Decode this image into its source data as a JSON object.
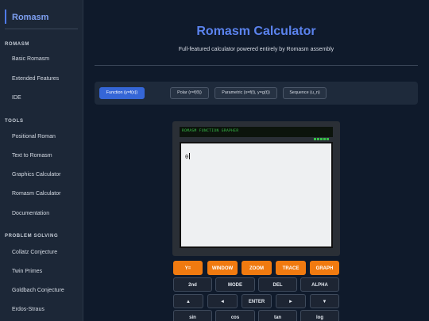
{
  "sidebar": {
    "brand": "Romasm",
    "sections": [
      {
        "title": "ROMASM",
        "items": [
          "Basic Romasm",
          "Extended Features",
          "IDE"
        ]
      },
      {
        "title": "TOOLS",
        "items": [
          "Positional Roman",
          "Text to Romasm",
          "Graphics Calculator",
          "Romasm Calculator",
          "Documentation"
        ]
      },
      {
        "title": "PROBLEM SOLVING",
        "items": [
          "Collatz Conjecture",
          "Twin Primes",
          "Goldbach Conjecture",
          "Erdos-Straus"
        ]
      }
    ]
  },
  "main": {
    "title": "Romasm Calculator",
    "subtitle": "Full-featured calculator powered entirely by Romasm assembly",
    "modes": [
      "Function (y=f(x))",
      "Polar (r=f(θ))",
      "Parametric (x=f(t), y=g(t))",
      "Sequence (u_n)"
    ],
    "active_mode": "Function (y=f(x))"
  },
  "calculator": {
    "display_title": "ROMASM FUNCTION GRAPHER",
    "screen_value": "0",
    "keys": {
      "row1": [
        "Y=",
        "WINDOW",
        "ZOOM",
        "TRACE",
        "GRAPH"
      ],
      "row2": [
        "2nd",
        "MODE",
        "DEL",
        "ALPHA"
      ],
      "row3": [
        "▲",
        "◄",
        "ENTER",
        "►",
        "▼"
      ],
      "row4": [
        "sin",
        "cos",
        "tan",
        "log"
      ]
    }
  },
  "colors": {
    "accent": "#3566d6",
    "title": "#5b83ee",
    "key_orange": "#f07a10",
    "lcd_green": "#39c14a",
    "background": "#0f1a2b",
    "sidebar": "#1c2737"
  }
}
